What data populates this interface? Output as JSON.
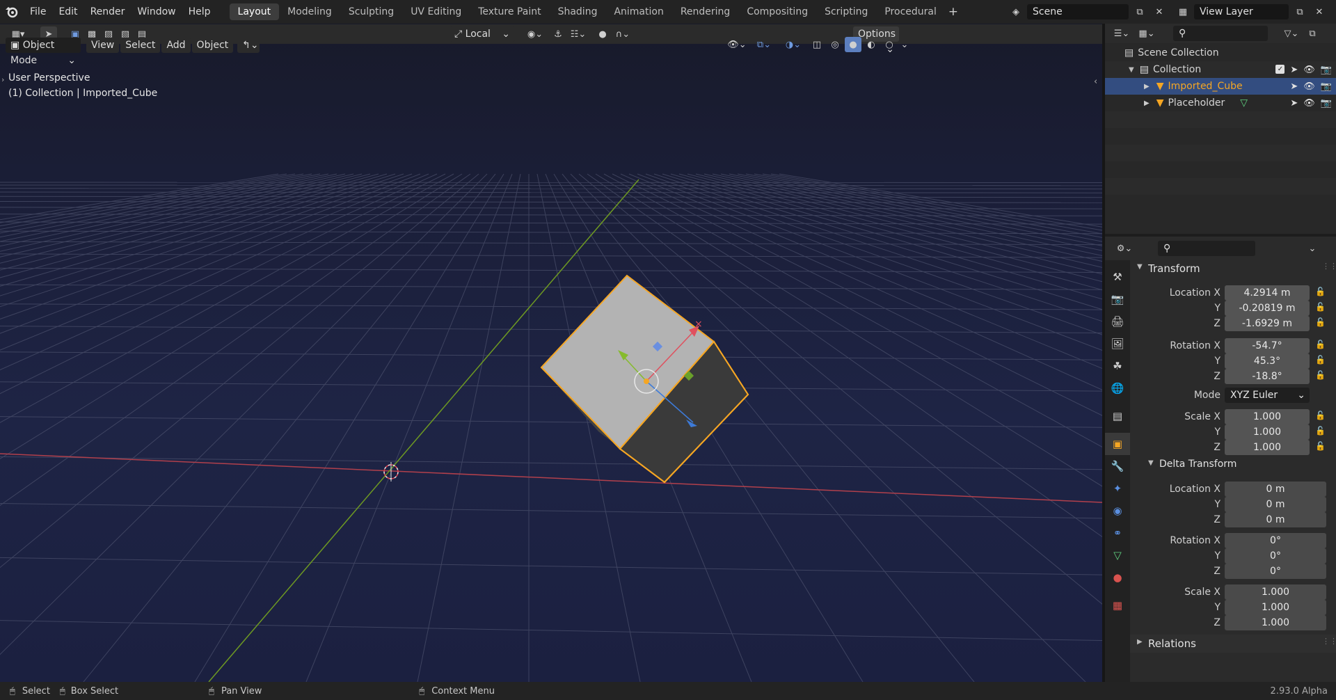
{
  "topbar": {
    "menus": [
      "File",
      "Edit",
      "Render",
      "Window",
      "Help"
    ],
    "workspaces": [
      "Layout",
      "Modeling",
      "Sculpting",
      "UV Editing",
      "Texture Paint",
      "Shading",
      "Animation",
      "Rendering",
      "Compositing",
      "Scripting",
      "Procedural"
    ],
    "active_workspace": "Layout",
    "scene": "Scene",
    "view_layer": "View Layer"
  },
  "tool_header": {
    "orientation": "Local",
    "options_label": "Options"
  },
  "viewport_header": {
    "mode": "Object Mode",
    "menus": [
      "View",
      "Select",
      "Add",
      "Object"
    ]
  },
  "viewport": {
    "perspective": "User Perspective",
    "collection_info": "(1) Collection | Imported_Cube"
  },
  "outliner": {
    "root": "Scene Collection",
    "collection": "Collection",
    "objects": [
      {
        "name": "Imported_Cube",
        "selected": true
      },
      {
        "name": "Placeholder",
        "selected": false
      }
    ]
  },
  "properties": {
    "transform": {
      "title": "Transform",
      "location_label": "Location X",
      "location": [
        "4.2914 m",
        "-0.20819 m",
        "-1.6929 m"
      ],
      "rotation_label": "Rotation X",
      "rotation": [
        "-54.7°",
        "45.3°",
        "-18.8°"
      ],
      "mode_label": "Mode",
      "mode": "XYZ Euler",
      "scale_label": "Scale X",
      "scale": [
        "1.000",
        "1.000",
        "1.000"
      ],
      "y_label": "Y",
      "z_label": "Z"
    },
    "delta_transform": {
      "title": "Delta Transform",
      "location": [
        "0 m",
        "0 m",
        "0 m"
      ],
      "rotation": [
        "0°",
        "0°",
        "0°"
      ],
      "scale": [
        "1.000",
        "1.000",
        "1.000"
      ]
    },
    "relations_title": "Relations"
  },
  "statusbar": {
    "select": "Select",
    "box_select": "Box Select",
    "pan_view": "Pan View",
    "context_menu": "Context Menu",
    "version": "2.93.0 Alpha"
  },
  "colors": {
    "accent_orange": "#f5a623",
    "selection_blue": "#334d80",
    "x_axis": "#c8414f",
    "y_axis": "#7ea22a",
    "z_axis": "#3d7bd9"
  }
}
